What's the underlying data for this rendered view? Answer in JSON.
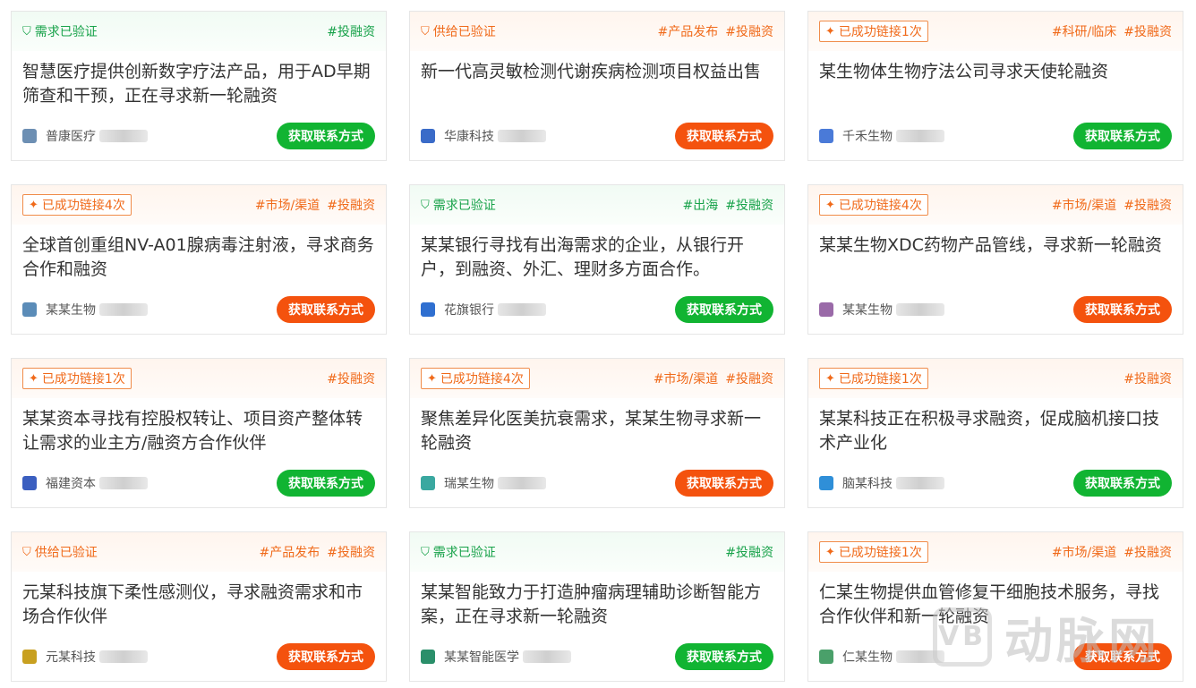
{
  "button_label": "获取联系方式",
  "colors": {
    "green": "#18a24a",
    "orange": "#f06a1a",
    "btn_green": "#11b432",
    "btn_orange": "#f4520e"
  },
  "cards": [
    {
      "theme": "green",
      "badge": {
        "text": "需求已验证",
        "style": "plain",
        "icon": "shield-check-icon"
      },
      "tags": [
        "#投融资"
      ],
      "title": "智慧医疗提供创新数字疗法产品，用于AD早期筛查和干预，正在寻求新一轮融资",
      "company": "普康医疗",
      "logo_color": "#6d8fb3",
      "btn": "green"
    },
    {
      "theme": "orange",
      "badge": {
        "text": "供给已验证",
        "style": "plain",
        "icon": "shield-check-icon"
      },
      "tags": [
        "#产品发布",
        "#投融资"
      ],
      "title": "新一代高灵敏检测代谢疾病检测项目权益出售",
      "company": "华康科技",
      "logo_color": "#3a6bc8",
      "btn": "orange"
    },
    {
      "theme": "orange",
      "badge": {
        "text": "已成功链接1次",
        "style": "outlined",
        "icon": "sparkle-icon"
      },
      "tags": [
        "#科研/临床",
        "#投融资"
      ],
      "title": "某生物体生物疗法公司寻求天使轮融资",
      "company": "千禾生物",
      "logo_color": "#4a7ad8",
      "btn": "green"
    },
    {
      "theme": "orange",
      "badge": {
        "text": "已成功链接4次",
        "style": "outlined",
        "icon": "sparkle-icon"
      },
      "tags": [
        "#市场/渠道",
        "#投融资"
      ],
      "title": "全球首创重组NV-A01腺病毒注射液，寻求商务合作和融资",
      "company": "某某生物",
      "logo_color": "#5b8cb8",
      "btn": "orange"
    },
    {
      "theme": "green",
      "badge": {
        "text": "需求已验证",
        "style": "plain",
        "icon": "shield-check-icon"
      },
      "tags": [
        "#出海",
        "#投融资"
      ],
      "title": "某某银行寻找有出海需求的企业，从银行开户，到融资、外汇、理财多方面合作。",
      "company": "花旗银行",
      "logo_color": "#2f6fd0",
      "btn": "green"
    },
    {
      "theme": "orange",
      "badge": {
        "text": "已成功链接4次",
        "style": "outlined",
        "icon": "sparkle-icon"
      },
      "tags": [
        "#市场/渠道",
        "#投融资"
      ],
      "title": "某某生物XDC药物产品管线，寻求新一轮融资",
      "company": "某某生物",
      "logo_color": "#9a6aa8",
      "btn": "orange"
    },
    {
      "theme": "orange",
      "badge": {
        "text": "已成功链接1次",
        "style": "outlined",
        "icon": "sparkle-icon"
      },
      "tags": [
        "#投融资"
      ],
      "title": "某某资本寻找有控股权转让、项目资产整体转让需求的业主方/融资方合作伙伴",
      "company": "福建资本",
      "logo_color": "#3b5fc0",
      "btn": "green"
    },
    {
      "theme": "orange",
      "badge": {
        "text": "已成功链接4次",
        "style": "outlined",
        "icon": "sparkle-icon"
      },
      "tags": [
        "#市场/渠道",
        "#投融资"
      ],
      "title": "聚焦差异化医美抗衰需求，某某生物寻求新一轮融资",
      "company": "瑞某生物",
      "logo_color": "#3aa8a0",
      "btn": "orange"
    },
    {
      "theme": "orange",
      "badge": {
        "text": "已成功链接1次",
        "style": "outlined",
        "icon": "sparkle-icon"
      },
      "tags": [
        "#投融资"
      ],
      "title": "某某科技正在积极寻求融资，促成脑机接口技术产业化",
      "company": "脑某科技",
      "logo_color": "#2f8fd8",
      "btn": "green"
    },
    {
      "theme": "orange",
      "badge": {
        "text": "供给已验证",
        "style": "plain",
        "icon": "shield-check-icon"
      },
      "tags": [
        "#产品发布",
        "#投融资"
      ],
      "title": "元某科技旗下柔性感测仪，寻求融资需求和市场合作伙伴",
      "company": "元某科技",
      "logo_color": "#c8a020",
      "btn": "orange"
    },
    {
      "theme": "green",
      "badge": {
        "text": "需求已验证",
        "style": "plain",
        "icon": "shield-check-icon"
      },
      "tags": [
        "#投融资"
      ],
      "title": "某某智能致力于打造肿瘤病理辅助诊断智能方案，正在寻求新一轮融资",
      "company": "某某智能医学",
      "logo_color": "#2a8f6a",
      "btn": "green"
    },
    {
      "theme": "orange",
      "badge": {
        "text": "已成功链接1次",
        "style": "outlined",
        "icon": "sparkle-icon"
      },
      "tags": [
        "#市场/渠道",
        "#投融资"
      ],
      "title": "仁某生物提供血管修复干细胞技术服务，寻找合作伙伴和新一轮融资",
      "company": "仁某生物",
      "logo_color": "#4aa06a",
      "btn": "orange"
    }
  ],
  "watermark": {
    "text": "动脉网",
    "mark": "VB"
  }
}
